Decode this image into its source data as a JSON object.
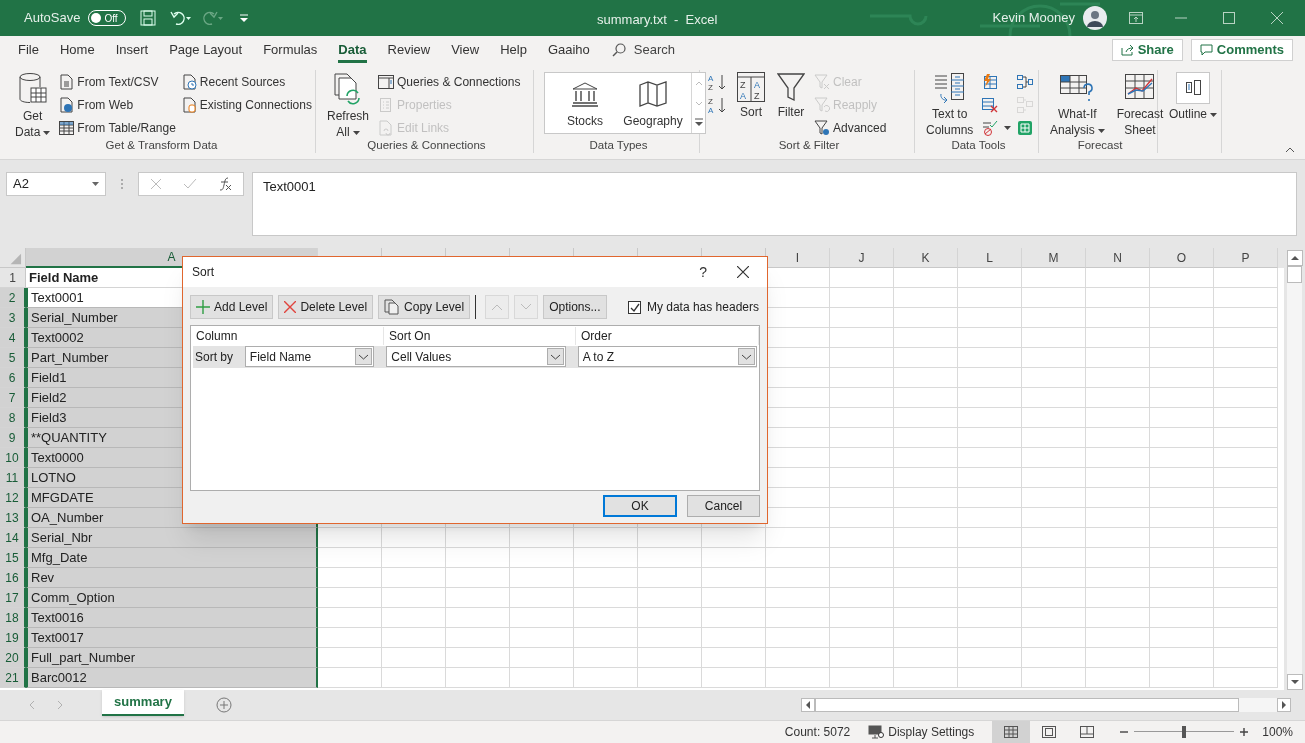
{
  "title_bar": {
    "autosave_label": "AutoSave",
    "autosave_toggle": {
      "label": "Off",
      "on": false
    },
    "title": "summary.txt  -  Excel",
    "user": "Kevin Mooney"
  },
  "menu_tabs": [
    {
      "label": "File",
      "selected": false
    },
    {
      "label": "Home",
      "selected": false
    },
    {
      "label": "Insert",
      "selected": false
    },
    {
      "label": "Page Layout",
      "selected": false
    },
    {
      "label": "Formulas",
      "selected": false
    },
    {
      "label": "Data",
      "selected": true
    },
    {
      "label": "Review",
      "selected": false
    },
    {
      "label": "View",
      "selected": false
    },
    {
      "label": "Help",
      "selected": false
    },
    {
      "label": "Gaaiho",
      "selected": false
    }
  ],
  "search": {
    "label": "Search"
  },
  "share_button": "Share",
  "comments_button": "Comments",
  "ribbon": {
    "groups": [
      {
        "label": "Get & Transform Data",
        "kind": "normal",
        "items": [
          {
            "kind": "large",
            "label": "Get Data",
            "dropdown": true,
            "disabled": false
          },
          {
            "kind": "small",
            "label": "From Text/CSV",
            "disabled": false
          },
          {
            "kind": "small",
            "label": "From Web",
            "disabled": false
          },
          {
            "kind": "small",
            "label": "From Table/Range",
            "disabled": false
          },
          {
            "kind": "small",
            "label": "Recent Sources",
            "disabled": false
          },
          {
            "kind": "small",
            "label": "Existing Connections",
            "disabled": false
          }
        ]
      },
      {
        "label": "Queries & Connections",
        "kind": "normal",
        "items": [
          {
            "kind": "large",
            "label": "Refresh All",
            "dropdown": true,
            "disabled": false
          },
          {
            "kind": "small",
            "label": "Queries & Connections",
            "disabled": false
          },
          {
            "kind": "small",
            "label": "Properties",
            "disabled": true
          },
          {
            "kind": "small",
            "label": "Edit Links",
            "disabled": true
          }
        ]
      },
      {
        "label": "Data Types",
        "kind": "gallery",
        "items": [
          {
            "kind": "large",
            "label": "Stocks",
            "disabled": false
          },
          {
            "kind": "large",
            "label": "Geography",
            "disabled": false
          }
        ]
      },
      {
        "label": "Sort & Filter",
        "kind": "normal",
        "items": [
          {
            "kind": "icon",
            "disabled": false,
            "glyphs": [
              "A",
              "Z"
            ]
          },
          {
            "kind": "icon",
            "disabled": false,
            "glyphs": [
              "Z",
              "A"
            ]
          },
          {
            "kind": "large",
            "label": "Sort",
            "disabled": false,
            "glyphs": [
              "Z",
              "A",
              "A",
              "Z"
            ]
          },
          {
            "kind": "large",
            "label": "Filter",
            "disabled": false
          },
          {
            "kind": "small",
            "label": "Clear",
            "disabled": true
          },
          {
            "kind": "small",
            "label": "Reapply",
            "disabled": true
          },
          {
            "kind": "small",
            "label": "Advanced",
            "disabled": false
          }
        ]
      },
      {
        "label": "Data Tools",
        "kind": "normal",
        "items": [
          {
            "kind": "large",
            "label": "Text to Columns",
            "disabled": false
          },
          {
            "kind": "icon",
            "disabled": false
          },
          {
            "kind": "icon",
            "disabled": false
          },
          {
            "kind": "icon",
            "disabled": false,
            "dropdown": true
          },
          {
            "kind": "icon",
            "disabled": false
          },
          {
            "kind": "icon",
            "disabled": true
          },
          {
            "kind": "icon",
            "disabled": false
          }
        ]
      },
      {
        "label": "Forecast",
        "kind": "normal",
        "items": [
          {
            "kind": "large",
            "label": "What-If Analysis",
            "dropdown": true,
            "disabled": false
          },
          {
            "kind": "large",
            "label": "Forecast Sheet",
            "disabled": false
          }
        ]
      },
      {
        "kind": "normal",
        "items": [
          {
            "kind": "large",
            "label": "Outline",
            "dropdown": true,
            "disabled": false
          }
        ]
      }
    ]
  },
  "formula_bar": {
    "name_box": "A2",
    "formula": "Text0001"
  },
  "columns": [
    "A",
    "I",
    "J",
    "K",
    "L",
    "M",
    "N",
    "O",
    "P"
  ],
  "rows": [
    {
      "number": "1",
      "value": "Field Name",
      "kind": "header",
      "selected": false
    },
    {
      "number": "2",
      "value": "Text0001",
      "kind": "data",
      "selected": true,
      "active": true
    },
    {
      "number": "3",
      "value": "Serial_Number",
      "kind": "data",
      "selected": true
    },
    {
      "number": "4",
      "value": "Text0002",
      "kind": "data",
      "selected": true
    },
    {
      "number": "5",
      "value": "Part_Number",
      "kind": "data",
      "selected": true
    },
    {
      "number": "6",
      "value": "Field1",
      "kind": "data",
      "selected": true
    },
    {
      "number": "7",
      "value": "Field2",
      "kind": "data",
      "selected": true
    },
    {
      "number": "8",
      "value": "Field3",
      "kind": "data",
      "selected": true
    },
    {
      "number": "9",
      "value": "**QUANTITY",
      "kind": "data",
      "selected": true
    },
    {
      "number": "10",
      "value": "Text0000",
      "kind": "data",
      "selected": true
    },
    {
      "number": "11",
      "value": "LOTNO",
      "kind": "data",
      "selected": true
    },
    {
      "number": "12",
      "value": "MFGDATE",
      "kind": "data",
      "selected": true
    },
    {
      "number": "13",
      "value": "OA_Number",
      "kind": "data",
      "selected": true
    },
    {
      "number": "14",
      "value": "Serial_Nbr",
      "kind": "data",
      "selected": true
    },
    {
      "number": "15",
      "value": "Mfg_Date",
      "kind": "data",
      "selected": true
    },
    {
      "number": "16",
      "value": "Rev",
      "kind": "data",
      "selected": true
    },
    {
      "number": "17",
      "value": "Comm_Option",
      "kind": "data",
      "selected": true
    },
    {
      "number": "18",
      "value": "Text0016",
      "kind": "data",
      "selected": true
    },
    {
      "number": "19",
      "value": "Text0017",
      "kind": "data",
      "selected": true
    },
    {
      "number": "20",
      "value": "Full_part_Number",
      "kind": "data",
      "selected": true
    },
    {
      "number": "21",
      "value": "Barc0012",
      "kind": "data",
      "selected": true
    }
  ],
  "sheet_tabs": [
    {
      "label": "summary",
      "selected": true
    }
  ],
  "status_bar": {
    "count": "Count: 5072",
    "display_settings": "Display Settings",
    "views": [
      {
        "selected": true
      },
      {
        "selected": false
      },
      {
        "selected": false
      }
    ],
    "zoom_slider": {
      "level": 0.5
    },
    "zoom": "100%"
  },
  "sort_dialog": {
    "title": "Sort",
    "help": "?",
    "buttons": [
      {
        "kind": "add",
        "label": "Add Level"
      },
      {
        "kind": "delete",
        "label": "Delete Level"
      },
      {
        "kind": "copy",
        "label": "Copy Level"
      },
      {
        "kind": "up",
        "disabled": true
      },
      {
        "kind": "down",
        "disabled": true
      },
      {
        "kind": "text",
        "label": "Options..."
      }
    ],
    "headers_checkbox": {
      "label": "My data has headers",
      "checked": true
    },
    "columns": [
      "Column",
      "Sort On",
      "Order"
    ],
    "levels": [
      {
        "label": "Sort by",
        "column": "Field Name",
        "sort_on": "Cell Values",
        "order": "A to Z"
      }
    ],
    "ok": "OK",
    "cancel": "Cancel"
  }
}
